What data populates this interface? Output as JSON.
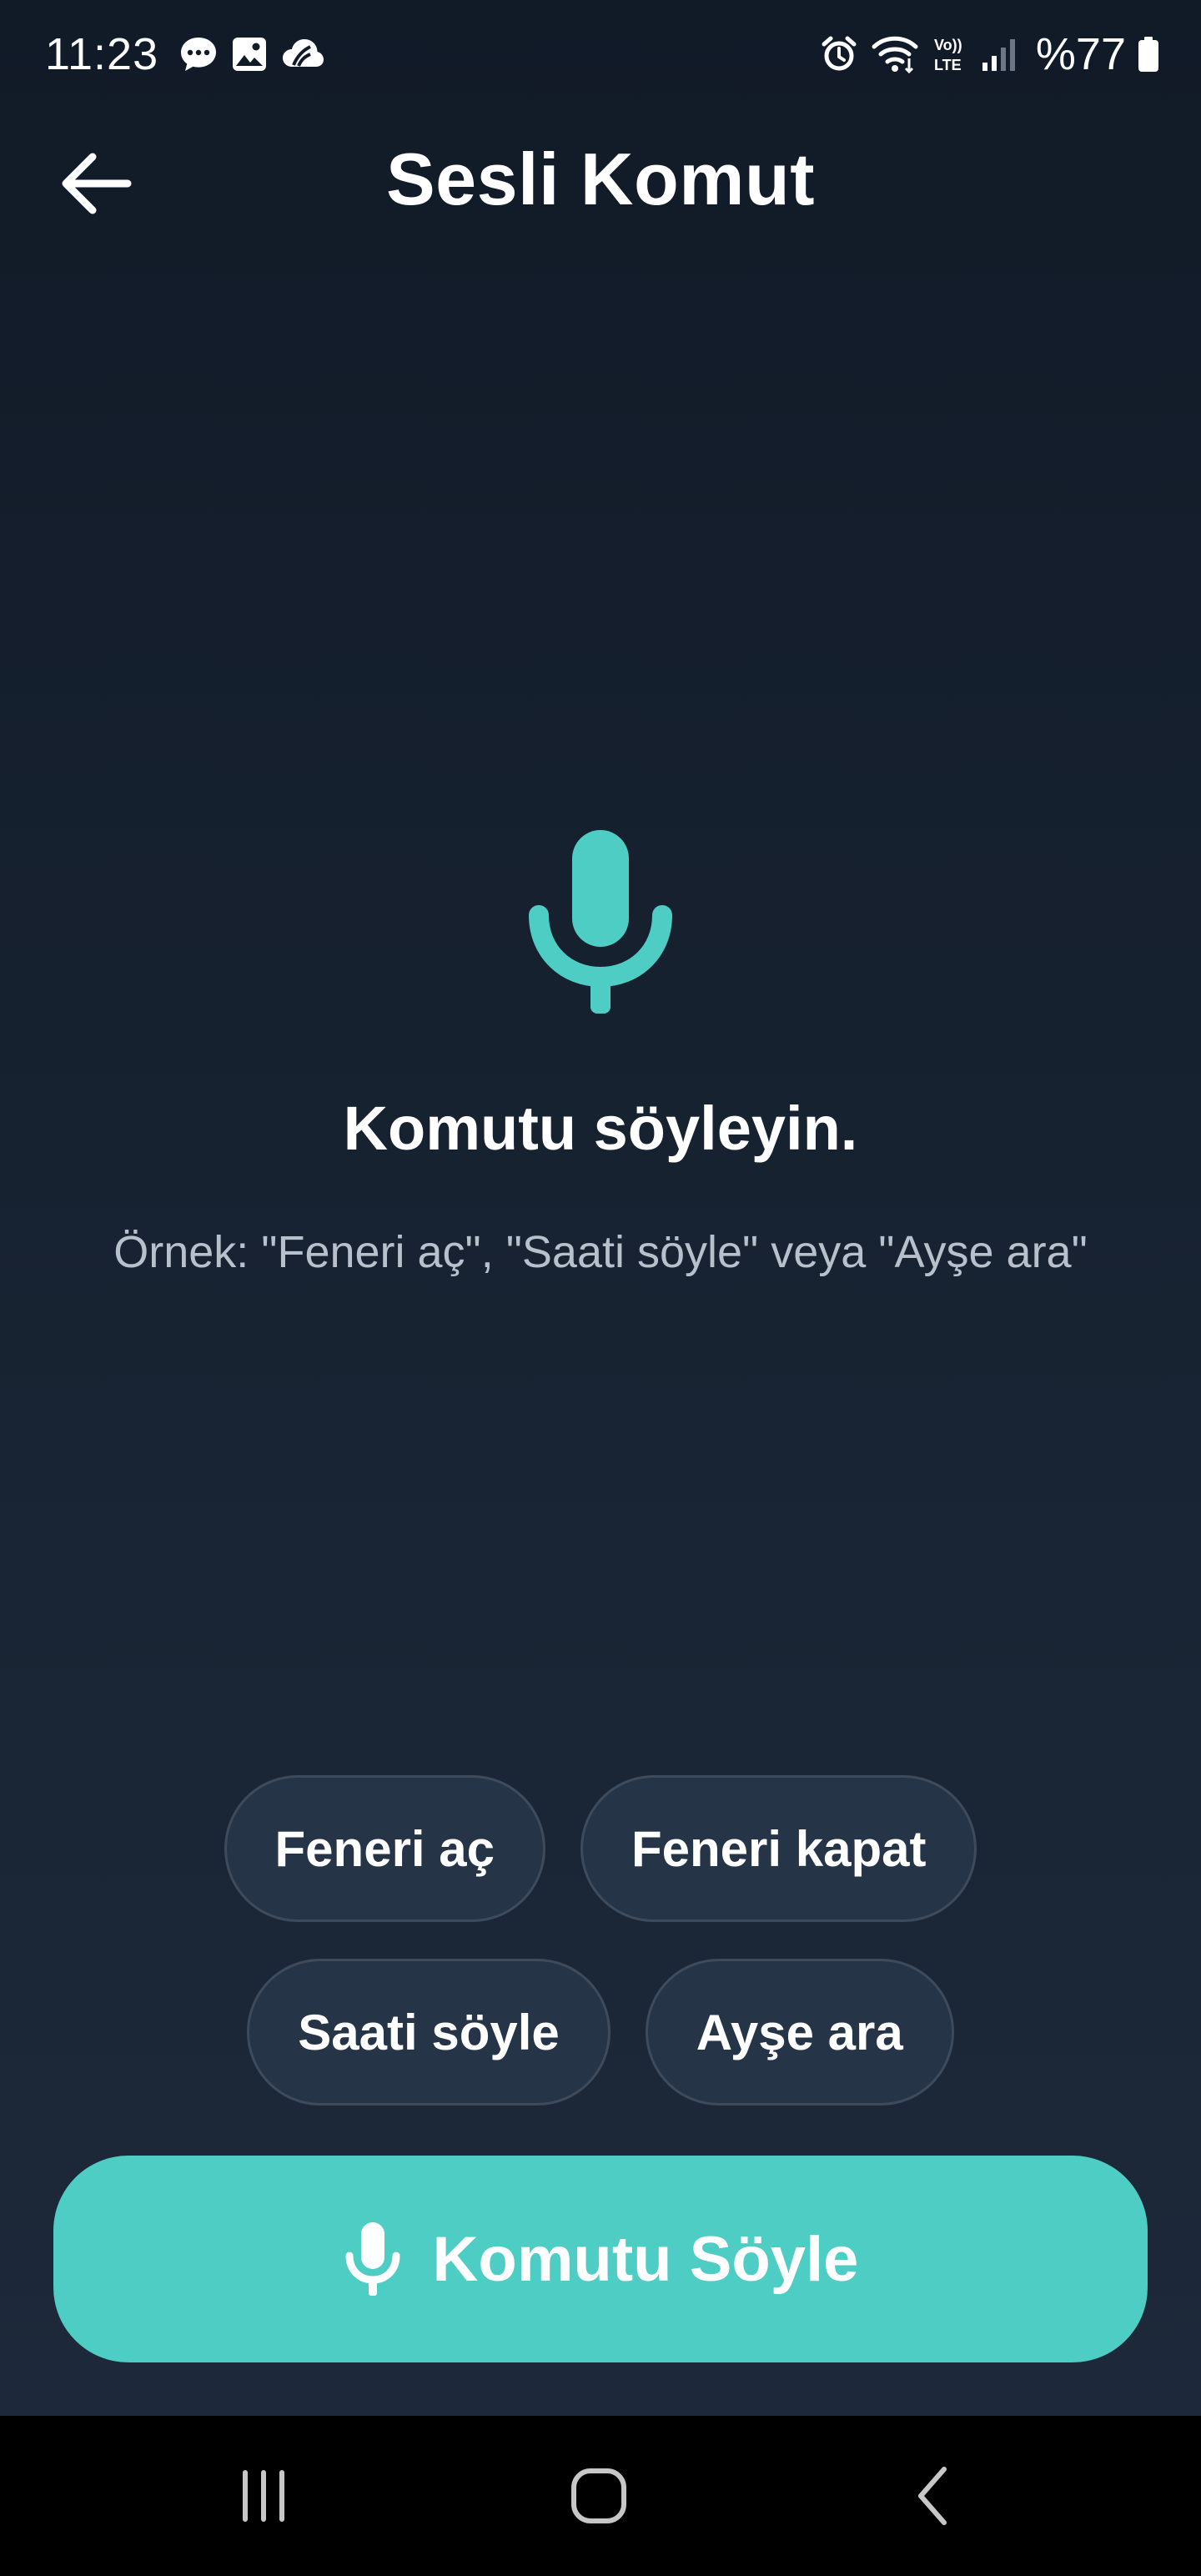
{
  "status_bar": {
    "time": "11:23",
    "battery": "%77",
    "left_icons": [
      "chat-bubble-icon",
      "image-icon",
      "cloud-app-icon"
    ],
    "right_icons": [
      "alarm-icon",
      "wifi-icon",
      "volte-icon",
      "signal-icon",
      "battery-icon"
    ]
  },
  "header": {
    "title": "Sesli Komut",
    "back_icon": "arrow-left-icon"
  },
  "hero": {
    "icon": "microphone-icon",
    "title": "Komutu söyleyin.",
    "example": "Örnek: \"Feneri aç\", \"Saati söyle\" veya \"Ayşe ara\""
  },
  "chips": {
    "row1": [
      "Feneri aç",
      "Feneri kapat"
    ],
    "row2": [
      "Saati söyle",
      "Ayşe ara"
    ]
  },
  "speak_button": {
    "label": "Komutu Söyle",
    "icon": "microphone-icon"
  },
  "nav_bar": {
    "items": [
      "recents-icon",
      "home-icon",
      "back-icon"
    ]
  },
  "colors": {
    "accent": "#4ecdc4",
    "background_top": "#111a27",
    "background_bottom": "#1e2a3b",
    "chip_background": "#263447",
    "chip_border": "#3d4b5d",
    "secondary_text": "#b7c0cb"
  }
}
